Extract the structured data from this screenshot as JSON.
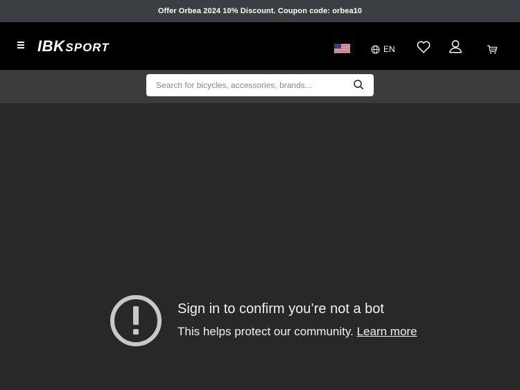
{
  "promo": {
    "text": "Offer Orbea 2024 10% Discount. Coupon code: orbea10"
  },
  "header": {
    "menu_icon": "hamburger-menu-icon",
    "logo": {
      "primary": "IBK",
      "secondary": "SPORT"
    },
    "flag_icon": "us-flag-icon",
    "language": {
      "icon": "globe-icon",
      "label": "EN"
    },
    "wishlist_icon": "heart-icon",
    "account_icon": "user-icon",
    "cart_icon": "cart-icon"
  },
  "search": {
    "placeholder": "Search for bicycles, accessories, brands...",
    "value": "",
    "icon": "search-icon"
  },
  "bot_check": {
    "icon": "exclamation-circle-icon",
    "title": "Sign in to confirm you’re not a bot",
    "body": "This helps protect our community.",
    "link": "Learn more"
  },
  "colors": {
    "promo_bg": "#3b3e42",
    "header_bg": "#000000",
    "search_strip_bg": "#3c3c3c",
    "content_bg": "#282828",
    "text": "#f1f1f1",
    "icon_gray": "#c8c8c8"
  }
}
